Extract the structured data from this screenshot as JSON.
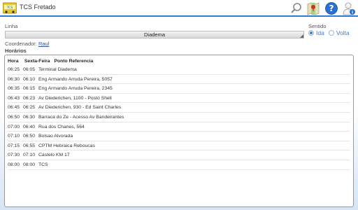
{
  "app": {
    "title": "TCS Fretado"
  },
  "toolbar": {
    "icons": [
      "search-icon",
      "map-icon",
      "help-icon",
      "user-info-icon"
    ]
  },
  "linha": {
    "label": "Linha",
    "selected": "Diadema"
  },
  "sentido": {
    "label": "Sentido",
    "options": [
      {
        "label": "Ida",
        "selected": true
      },
      {
        "label": "Volta",
        "selected": false
      }
    ]
  },
  "coordenador": {
    "label": "Coordenador:",
    "value": "Raul"
  },
  "horarios": {
    "label": "Horários",
    "columns": [
      "Hora",
      "Sexta-Feira",
      "Ponto Referencia"
    ],
    "rows": [
      {
        "hora": "06:25",
        "sexta": "06:05",
        "ponto": "Terminal Diadema"
      },
      {
        "hora": "06:30",
        "sexta": "06:10",
        "ponto": "Eng Armando Arruda Pereira, 5057"
      },
      {
        "hora": "06:35",
        "sexta": "06:15",
        "ponto": "Eng Armando Arruda Pereira, 2345"
      },
      {
        "hora": "06:43",
        "sexta": "06:23",
        "ponto": "Av Diederichen, 1100 - Posto Shell"
      },
      {
        "hora": "06:45",
        "sexta": "06:25",
        "ponto": "Av Diederichen, 930 - Ed Saint Charles"
      },
      {
        "hora": "06:50",
        "sexta": "06:30",
        "ponto": "Barraca do Ze - Acesso Av Bandeirantes"
      },
      {
        "hora": "07:00",
        "sexta": "06:40",
        "ponto": "Rua dos Chanes, 564"
      },
      {
        "hora": "07:10",
        "sexta": "06:50",
        "ponto": "Bolsao Alvorada"
      },
      {
        "hora": "07:15",
        "sexta": "06:55",
        "ponto": "CPTM Hebraica Reboucas"
      },
      {
        "hora": "07:30",
        "sexta": "07:10",
        "ponto": "Castelo KM 17"
      },
      {
        "hora": "08:00",
        "sexta": "08:00",
        "ponto": "TCS"
      }
    ]
  },
  "colors": {
    "accent": "#2f79d8",
    "radio": "#3a7fd0",
    "link": "#2b55b0"
  }
}
